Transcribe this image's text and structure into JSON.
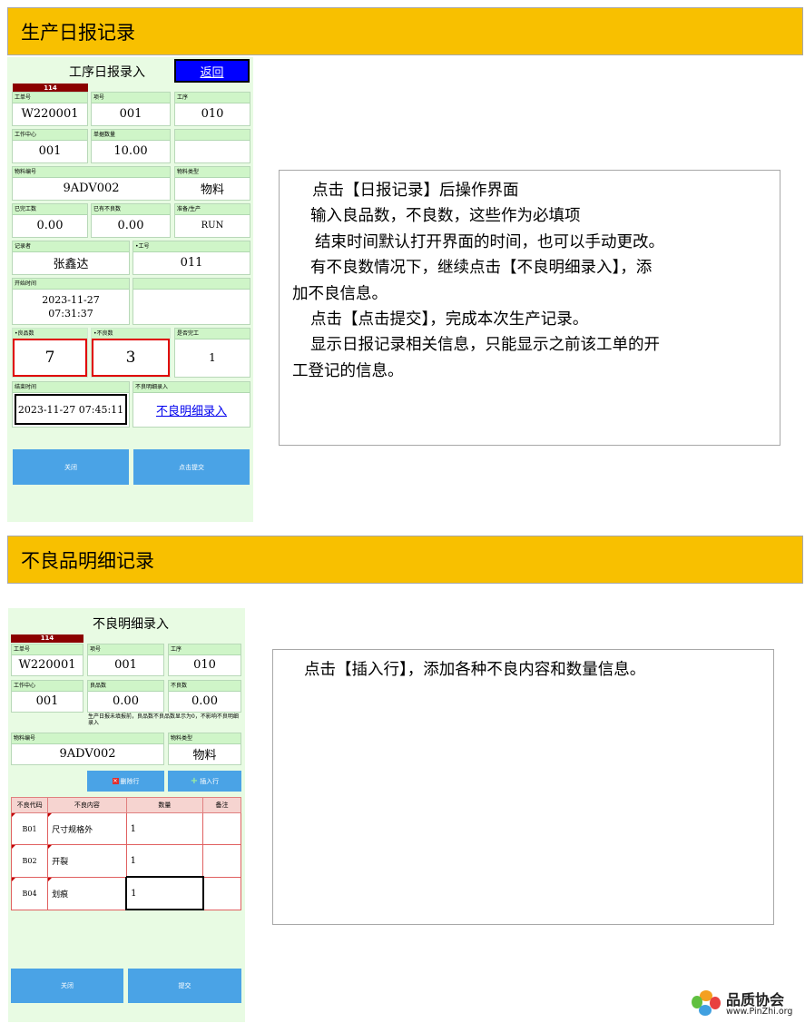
{
  "section1": {
    "banner": "生产日报记录",
    "panel": {
      "title": "工序日报录入",
      "back": "返回",
      "badge": "114",
      "fields": {
        "work_order": {
          "label": "工单号",
          "value": "W220001"
        },
        "item_no": {
          "label": "项号",
          "value": "001"
        },
        "process": {
          "label": "工序",
          "value": "010"
        },
        "work_center": {
          "label": "工作中心",
          "value": "001"
        },
        "order_qty": {
          "label": "单据数量",
          "value": "10.00"
        },
        "material_no": {
          "label": "物料编号",
          "value": "9ADV002"
        },
        "material_type": {
          "label": "物料类型",
          "value": "物料"
        },
        "done_qty": {
          "label": "已完工数",
          "value": "0.00"
        },
        "bad_done": {
          "label": "已有不良数",
          "value": "0.00"
        },
        "prep_prod": {
          "label": "准备/生产",
          "value": "RUN"
        },
        "recorder": {
          "label": "记录者",
          "value": "张鑫达"
        },
        "worker_id": {
          "label": "•工号",
          "value": "011"
        },
        "start_time": {
          "label": "开始时间",
          "value_line1": "2023-11-27",
          "value_line2": "07:31:37"
        },
        "good_qty": {
          "label": "•良品数",
          "value": "7"
        },
        "bad_qty": {
          "label": "•不良数",
          "value": "3"
        },
        "is_finished": {
          "label": "是否完工",
          "value": "1"
        },
        "end_time": {
          "label": "结束时间",
          "value": "2023-11-27 07:45:11"
        },
        "bad_detail": {
          "label": "不良明细录入",
          "value": "不良明细录入"
        }
      },
      "close_btn": "关闭",
      "submit_btn": "点击提交"
    },
    "note": [
      "点击【日报记录】后操作界面",
      "输入良品数，不良数，这些作为必填项",
      "结束时间默认打开界面的时间，也可以手动更改。",
      "有不良数情况下，继续点击【不良明细录入】，添",
      "加不良信息。",
      "点击【点击提交】，完成本次生产记录。",
      "显示日报记录相关信息，只能显示之前该工单的开",
      "工登记的信息。"
    ]
  },
  "section2": {
    "banner": "不良品明细记录",
    "panel": {
      "title": "不良明细录入",
      "badge": "114",
      "fields": {
        "work_order": {
          "label": "工单号",
          "value": "W220001"
        },
        "item_no": {
          "label": "项号",
          "value": "001"
        },
        "process": {
          "label": "工序",
          "value": "010"
        },
        "work_center": {
          "label": "工作中心",
          "value": "001"
        },
        "good_qty": {
          "label": "良品数",
          "value": "0.00"
        },
        "bad_qty": {
          "label": "不良数",
          "value": "0.00"
        },
        "material_no": {
          "label": "物料编号",
          "value": "9ADV002"
        },
        "material_type": {
          "label": "物料类型",
          "value": "物料"
        }
      },
      "hint": "生产日报未填报前，良品数不良品数显示为0，不影响不良明细录入",
      "delete_row": "删除行",
      "insert_row": "插入行",
      "table": {
        "headers": [
          "不良代码",
          "不良内容",
          "数量",
          "备注"
        ],
        "rows": [
          {
            "code": "B01",
            "content": "尺寸规格外",
            "qty": "1",
            "note": ""
          },
          {
            "code": "B02",
            "content": "开裂",
            "qty": "1",
            "note": ""
          },
          {
            "code": "B04",
            "content": "划痕",
            "qty": "1",
            "note": ""
          }
        ]
      },
      "close_btn": "关闭",
      "submit_btn": "提交"
    },
    "note": [
      "点击【插入行】，添加各种不良内容和数量信息。"
    ]
  },
  "logo": {
    "name": "品质协会",
    "url": "www.PinZhi.org"
  },
  "colors": {
    "banner": "#f8c000",
    "panel": "#e8fbe3",
    "button": "#4aa3e6",
    "back_button": "#0000ff",
    "badge": "#8b0000"
  }
}
